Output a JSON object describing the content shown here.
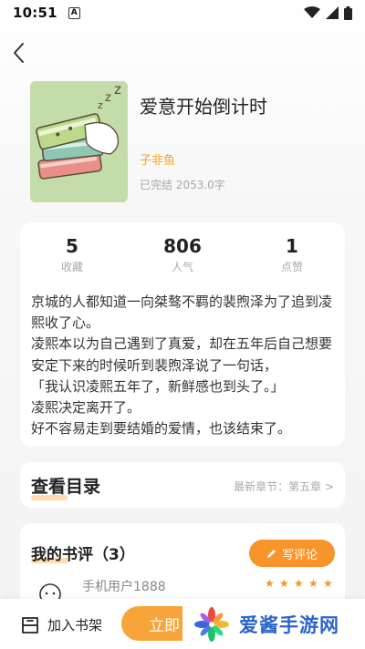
{
  "status": {
    "time": "10:51",
    "a_badge": "A"
  },
  "book": {
    "title": "爱意开始倒计时",
    "author": "子非鱼",
    "meta": "已完结 2053.0字"
  },
  "stats": [
    {
      "value": "5",
      "label": "收藏"
    },
    {
      "value": "806",
      "label": "人气"
    },
    {
      "value": "1",
      "label": "点赞"
    }
  ],
  "synopsis": [
    "京城的人都知道一向桀骜不羁的裴煦泽为了追到凌熙收了心。",
    "凌熙本以为自己遇到了真爱，却在五年后自己想要安定下来的时候听到裴煦泽说了一句话，",
    "「我认识凌熙五年了，新鲜感也到头了。」",
    "凌熙决定离开了。",
    "好不容易走到要结婚的爱情，也该结束了。"
  ],
  "toc": {
    "title": "查看目录",
    "latest": "最新章节：第五章 >"
  },
  "reviews": {
    "title": "我的书评（3）",
    "write_label": "写评论",
    "first_user": "手机用户1888",
    "first_rating": 5
  },
  "bottom": {
    "add_shelf": "加入书架",
    "read_now": "立即"
  },
  "watermark": {
    "text": "爱酱手游网"
  },
  "colors": {
    "accent": "#f7942a",
    "author": "#f5a623"
  }
}
